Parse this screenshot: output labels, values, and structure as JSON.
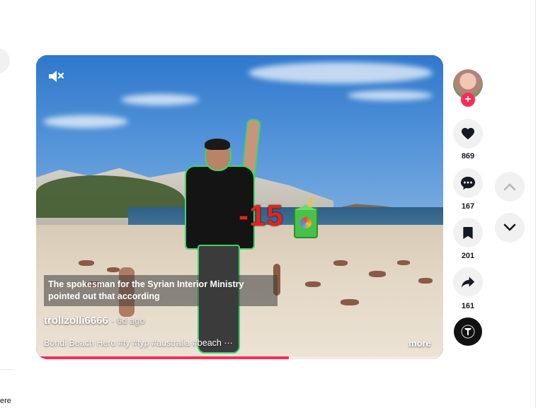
{
  "left_panel": {
    "cut_text": "ere"
  },
  "video": {
    "overlay_effect_text": "-15",
    "caption_line1": "The spokesman for the Syrian Interior Ministry",
    "caption_line2": "pointed out that according",
    "username": "trollzolli6666",
    "posted": "· 6d ago",
    "description": "Bondi Beach Hero #fy #fyp #australia #beach ···",
    "more_label": "more",
    "progress": 0.62,
    "muted": true
  },
  "actions": {
    "likes": "869",
    "comments": "167",
    "saves": "201",
    "shares": "161"
  },
  "icons": {
    "mute": "speaker-mute-icon",
    "like": "heart-icon",
    "comment": "comment-icon",
    "save": "bookmark-icon",
    "share": "share-icon",
    "up": "chevron-up-icon",
    "down": "chevron-down-icon"
  },
  "colors": {
    "accent": "#fe2c55",
    "button_bg": "#f1f1f2"
  }
}
